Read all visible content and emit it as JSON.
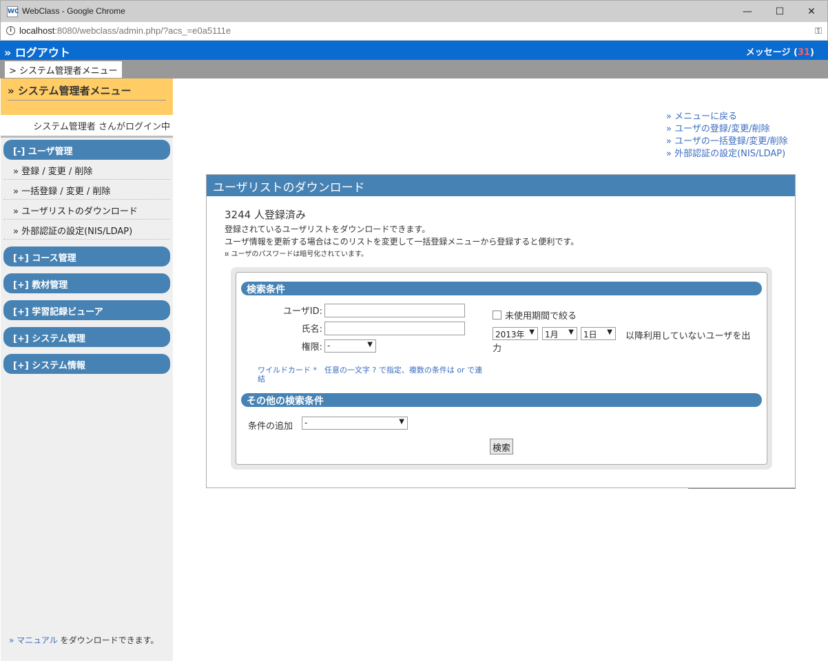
{
  "window": {
    "title": "WebClass - Google Chrome",
    "favicon_text": "WC",
    "minimize": "—",
    "maximize": "☐",
    "close": "✕"
  },
  "address": {
    "host": "localhost",
    "rest": ":8080/webclass/admin.php/?acs_=e0a5111e"
  },
  "topbar": {
    "logout": "» ログアウト",
    "messages_label": "メッセージ (",
    "messages_count": "31",
    "messages_close": ")"
  },
  "breadcrumb": {
    "tab": "> システム管理者メニュー"
  },
  "sidebar": {
    "heading": "» システム管理者メニュー",
    "login_info": "システム管理者 さんがログイン中",
    "user_mgmt": "[-] ユーザ管理",
    "items": [
      "» 登録 / 変更 / 削除",
      "» 一括登録 / 変更 / 削除",
      "» ユーザリストのダウンロード",
      "» 外部認証の設定(NIS/LDAP)"
    ],
    "sections": [
      "[+] コース管理",
      "[+] 教材管理",
      "[+] 学習記録ビューア",
      "[+] システム管理",
      "[+] システム情報"
    ],
    "footer_link": "» マニュアル",
    "footer_text": " をダウンロードできます。"
  },
  "quick_links": [
    "» メニューに戻る",
    "» ユーザの登録/変更/削除",
    "» ユーザの一括登録/変更/削除",
    "» 外部認証の設定(NIS/LDAP)"
  ],
  "panel": {
    "title": "ユーザリストのダウンロード",
    "count": "3244 人登録済み",
    "desc1": "登録されているユーザリストをダウンロードできます。",
    "desc2": "ユーザ情報を更新する場合はこのリストを変更して一括登録メニューから登録すると便利です。",
    "note": "¤ ユーザのパスワードは暗号化されています。"
  },
  "search": {
    "header": "検索条件",
    "userid_label": "ユーザID:",
    "userid_value": "",
    "name_label": "氏名:",
    "name_value": "",
    "perm_label": "権限:",
    "perm_value": "-",
    "unused_label": "未使用期間で絞る",
    "year": "2013年",
    "month": "1月",
    "day": "1日",
    "since_text_1": "以降利用していないユーザを出",
    "since_text_2": "力",
    "wildcard": "ワイルドカード *　任意の一文字 ? で指定、複数の条件は or で連結",
    "other_header": "その他の検索条件",
    "add_cond_label": "条件の追加",
    "add_cond_value": "-",
    "search_button": "検索"
  },
  "icons": {
    "info": "info-icon",
    "key": "key-icon",
    "dropdown": "chevron-down-icon"
  }
}
